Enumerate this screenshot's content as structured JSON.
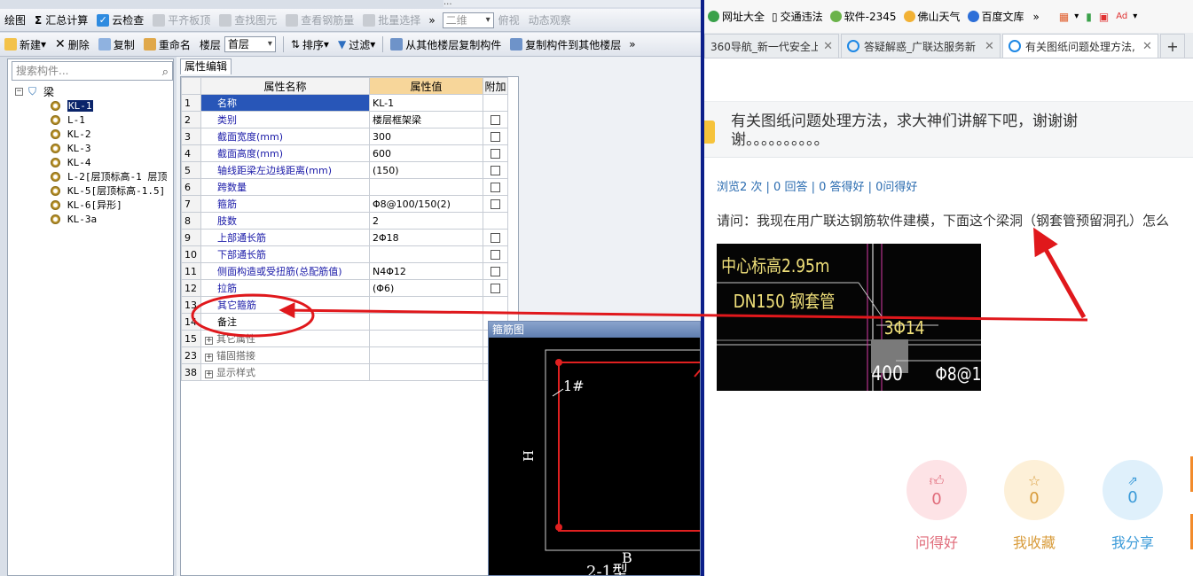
{
  "app": {
    "top_strip_text": "...",
    "toolbar1": {
      "items": [
        "绘图",
        "汇总计算",
        "云检查",
        "平齐板顶",
        "查找图元",
        "查看钢筋量",
        "批量选择"
      ],
      "view_combo": "二维",
      "view_items": [
        "俯视",
        "动态观察"
      ],
      "more": "»"
    },
    "toolbar2": {
      "new": "新建",
      "delete": "删除",
      "copy": "复制",
      "rename": "重命名",
      "floor_label": "楼层",
      "floor_value": "首层",
      "sort": "排序",
      "filter": "过滤",
      "copy_from": "从其他楼层复制构件",
      "copy_to": "复制构件到其他楼层",
      "more": "»"
    },
    "search_placeholder": "搜索构件...",
    "tree": {
      "root": "梁",
      "items": [
        "KL-1",
        "L-1",
        "KL-2",
        "KL-3",
        "KL-4",
        "L-2[层顶标高-1 层顶",
        "KL-5[层顶标高-1.5]",
        "KL-6[异形]",
        "KL-3a"
      ]
    },
    "prop_tab": "属性编辑",
    "headers": {
      "num": "",
      "name": "属性名称",
      "value": "属性值",
      "add": "附加"
    },
    "rows": [
      {
        "n": "1",
        "name": "名称",
        "value": "KL-1",
        "cb": false
      },
      {
        "n": "2",
        "name": "类别",
        "value": "楼层框架梁",
        "cb": true
      },
      {
        "n": "3",
        "name": "截面宽度(mm)",
        "value": "300",
        "cb": true
      },
      {
        "n": "4",
        "name": "截面高度(mm)",
        "value": "600",
        "cb": true
      },
      {
        "n": "5",
        "name": "轴线距梁左边线距离(mm)",
        "value": "(150)",
        "cb": true
      },
      {
        "n": "6",
        "name": "跨数量",
        "value": "",
        "cb": true
      },
      {
        "n": "7",
        "name": "箍筋",
        "value": "Φ8@100/150(2)",
        "cb": true
      },
      {
        "n": "8",
        "name": "肢数",
        "value": "2",
        "cb": false
      },
      {
        "n": "9",
        "name": "上部通长筋",
        "value": "2Φ18",
        "cb": true
      },
      {
        "n": "10",
        "name": "下部通长筋",
        "value": "",
        "cb": true
      },
      {
        "n": "11",
        "name": "侧面构造或受扭筋(总配筋值)",
        "value": "N4Φ12",
        "cb": true
      },
      {
        "n": "12",
        "name": "拉筋",
        "value": "(Φ6)",
        "cb": true
      },
      {
        "n": "13",
        "name": "其它箍筋",
        "value": "",
        "cb": false
      },
      {
        "n": "14",
        "name": "备注",
        "value": "",
        "cb": false
      }
    ],
    "groups": [
      {
        "n": "15",
        "name": "其它属性"
      },
      {
        "n": "23",
        "name": "锚固搭接"
      },
      {
        "n": "38",
        "name": "显示样式"
      }
    ],
    "stirrup": {
      "title": "箍筋图",
      "label_1": "1#",
      "label_h": "H",
      "label_b": "B",
      "type": "2-1型"
    }
  },
  "browser": {
    "bookmarks": [
      "网址大全",
      "交通违法",
      "软件-2345",
      "佛山天气",
      "百度文库"
    ],
    "bookmarks_more": "»",
    "tabs": [
      {
        "title": "360导航_新一代安全上网"
      },
      {
        "title": "答疑解惑_广联达服务新"
      },
      {
        "title": "有关图纸问题处理方法,"
      }
    ],
    "new_tab": "+",
    "question_title": "有关图纸问题处理方法，求大神们讲解下吧，谢谢谢谢。。。。。。。。。。",
    "stats": "浏览2 次 | 0 回答 | 0 答得好 | 0问得好",
    "body": "请问：我现在用广联达钢筋软件建模，下面这个梁洞（钢套管预留洞孔）怎么",
    "cad": {
      "line1": "中心标高2.95m",
      "line2": "DN150 钢套管",
      "line3": "3Φ14",
      "line4": "400",
      "line5": "Φ8@1"
    },
    "actions": [
      {
        "label": "问得好",
        "count": "0",
        "color": "#e06b7a",
        "bg": "#fde3e6"
      },
      {
        "label": "我收藏",
        "count": "0",
        "color": "#d89b3a",
        "bg": "#fdf0d8"
      },
      {
        "label": "我分享",
        "count": "0",
        "color": "#3a9ad8",
        "bg": "#dff0fb"
      }
    ]
  },
  "colors": {
    "annotation": "#e0181c",
    "divider": "#0c1f8a",
    "selected_row": "#2856b8",
    "header_value": "#f7d69a"
  }
}
